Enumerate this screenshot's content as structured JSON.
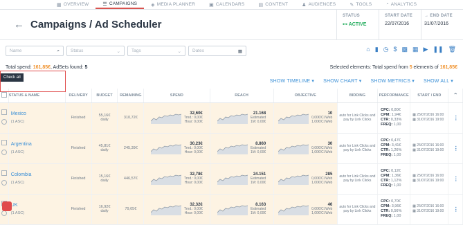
{
  "nav": [
    {
      "label": "OVERVIEW",
      "icon": "grid-icon",
      "glyph": "▦",
      "active": false
    },
    {
      "label": "CAMPAIGNS",
      "icon": "list-icon",
      "glyph": "☰",
      "active": true
    },
    {
      "label": "MEDIA PLANNER",
      "icon": "media-icon",
      "glyph": "◈",
      "active": false
    },
    {
      "label": "CALENDARS",
      "icon": "calendar-icon",
      "glyph": "▣",
      "active": false
    },
    {
      "label": "CONTENT",
      "icon": "content-icon",
      "glyph": "▤",
      "active": false
    },
    {
      "label": "AUDIENCES",
      "icon": "people-icon",
      "glyph": "♟",
      "active": false
    },
    {
      "label": "TOOLS",
      "icon": "wrench-icon",
      "glyph": "✎",
      "active": false
    },
    {
      "label": "ANALYTICS",
      "icon": "analytics-icon",
      "glyph": "◔",
      "active": false
    }
  ],
  "header": {
    "title": "Campaigns / Ad Scheduler",
    "status_label": "STATUS",
    "status_value": "ACTIVE",
    "start_label": "START DATE",
    "start_value": "22/07/2016",
    "end_label": "END DATE",
    "end_value": "31/07/2016"
  },
  "filters": {
    "name_placeholder": "Name",
    "status_placeholder": "Status",
    "tags_placeholder": "Tags",
    "dates_placeholder": "Dates"
  },
  "summary": {
    "total_spend_label": "Total spend: ",
    "total_spend": "161,85€",
    "adsets_label": ", AdSets found: ",
    "adsets": "5",
    "selected_label": "Selected elements: Total spend from ",
    "selected_count": "5",
    "selected_of": " elements of ",
    "selected_total": "161,85€"
  },
  "show": {
    "timeline": "SHOW TIMELINE ▾",
    "chart": "SHOW CHART ▾",
    "metrics": "SHOW METRICS ▾",
    "all": "SHOW ALL ▾"
  },
  "tooltip": "Check all",
  "columns": {
    "status": "STATUS & NAME",
    "delivery": "DELIVERY",
    "budget": "BUDGET",
    "remaining": "REMAINING",
    "spend": "SPEND",
    "reach": "REACH",
    "objective": "OBJECTIVE",
    "bidding": "BIDDING",
    "performance": "PERFORMANCE",
    "startend": "START / END"
  },
  "rows": [
    {
      "name": "Mexico",
      "tag": "(1 ASC)",
      "delivery": "Finished",
      "budget": "55,16€",
      "budget_sub": "daily",
      "remaining": "310,72€",
      "spend": "32,60€",
      "spend_sub1": "Trnd.: 0,00€",
      "spend_sub2": "Hour: 0,00€",
      "reach": "21.168",
      "reach_sub1": "Estimated",
      "reach_sub2": "1M: 0,00€",
      "obj": "10",
      "obj_sub1": "0,00€/Cl.Web",
      "obj_sub2": "1,00€/Cl.Web",
      "bidding": "auto for Link Clicks and pay by Link Clicks",
      "cpc": "0,80€",
      "cpm": "1,94€",
      "ctr": "0,33%",
      "freq": "1,00",
      "start": "25/07/2016 16:00",
      "end": "31/07/2016 19:00"
    },
    {
      "name": "Argentina",
      "tag": "(1 ASC)",
      "delivery": "Finished",
      "budget": "45,81€",
      "budget_sub": "daily",
      "remaining": "245,39€",
      "spend": "30,23€",
      "spend_sub1": "Trnd.: 0,00€",
      "spend_sub2": "Hour: 0,00€",
      "reach": "8.860",
      "reach_sub1": "Estimated",
      "reach_sub2": "1M: 0,00€",
      "obj": "30",
      "obj_sub1": "0,00€/Cl.Web",
      "obj_sub2": "1,00€/Cl.Web",
      "bidding": "auto for Link Clicks and pay by Link Clicks",
      "cpc": "0,47€",
      "cpm": "3,41€",
      "ctr": "1,26%",
      "freq": "1,00",
      "start": "25/07/2016 16:00",
      "end": "31/07/2016 19:00"
    },
    {
      "name": "Colombia",
      "tag": "(1 ASC)",
      "delivery": "Finished",
      "budget": "15,16€",
      "budget_sub": "daily",
      "remaining": "446,57€",
      "spend": "32,78€",
      "spend_sub1": "Trnd.: 0,00€",
      "spend_sub2": "Hour: 0,00€",
      "reach": "24.151",
      "reach_sub1": "Estimated",
      "reach_sub2": "1M: 0,00€",
      "obj": "285",
      "obj_sub1": "0,00€/Cl.Web",
      "obj_sub2": "1,00€/Cl.Web",
      "bidding": "auto for Link Clicks and pay by Link Clicks",
      "cpc": "0,12€",
      "cpm": "1,36€",
      "ctr": "1,12%",
      "freq": "1,00",
      "start": "25/07/2016 16:00",
      "end": "31/07/2016 19:00"
    },
    {
      "name": "UK",
      "tag": "(1 ASC)",
      "delivery": "Finished",
      "budget": "16,92€",
      "budget_sub": "daily",
      "remaining": "79,05€",
      "spend": "32,32€",
      "spend_sub1": "Trnd.: 0,00€",
      "spend_sub2": "Hour: 0,00€",
      "reach": "8.163",
      "reach_sub1": "Estimated",
      "reach_sub2": "1M: 0,00€",
      "obj": "46",
      "obj_sub1": "0,00€/Cl.Web",
      "obj_sub2": "1,00€/Cl.Web",
      "bidding": "auto for Link Clicks and pay by Link Clicks",
      "cpc": "0,70€",
      "cpm": "3,96€",
      "ctr": "0,56%",
      "freq": "1,00",
      "start": "25/07/2016 16:00",
      "end": "31/07/2016 19:00"
    }
  ]
}
